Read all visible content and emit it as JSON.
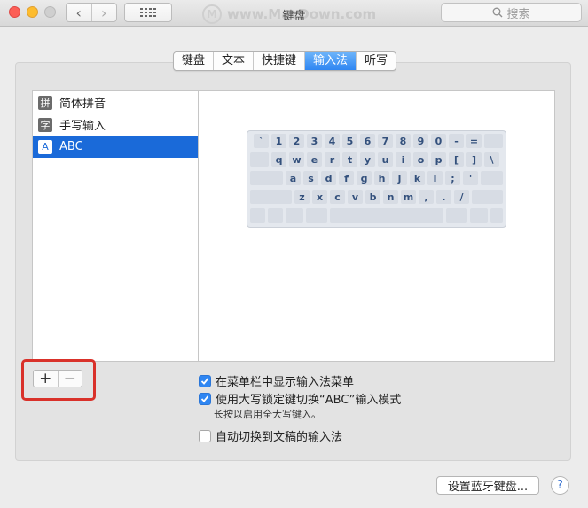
{
  "window": {
    "title": "键盘"
  },
  "toolbar": {
    "back_glyph": "‹",
    "forward_glyph": "›",
    "search_placeholder": "搜索"
  },
  "watermark": {
    "logo": "M",
    "text": "www.MacDown.com"
  },
  "tabs": [
    {
      "label": "键盘",
      "active": false
    },
    {
      "label": "文本",
      "active": false
    },
    {
      "label": "快捷键",
      "active": false
    },
    {
      "label": "输入法",
      "active": true
    },
    {
      "label": "听写",
      "active": false
    }
  ],
  "input_sources": [
    {
      "icon_text": "拼",
      "label": "简体拼音",
      "selected": false
    },
    {
      "icon_text": "字",
      "label": "手写输入",
      "selected": false
    },
    {
      "icon_text": "A",
      "label": "ABC",
      "selected": true
    }
  ],
  "keyboard_rows": [
    [
      "`",
      "1",
      "2",
      "3",
      "4",
      "5",
      "6",
      "7",
      "8",
      "9",
      "0",
      "-",
      "="
    ],
    [
      "q",
      "w",
      "e",
      "r",
      "t",
      "y",
      "u",
      "i",
      "o",
      "p",
      "[",
      "]",
      "\\"
    ],
    [
      "a",
      "s",
      "d",
      "f",
      "g",
      "h",
      "j",
      "k",
      "l",
      ";",
      "'"
    ],
    [
      "z",
      "x",
      "c",
      "v",
      "b",
      "n",
      "m",
      ",",
      ".",
      "/"
    ]
  ],
  "list_buttons": {
    "add": "+",
    "remove": "−"
  },
  "options": {
    "show_menu": {
      "label": "在菜单栏中显示输入法菜单",
      "checked": true
    },
    "caps_switch": {
      "label": "使用大写锁定键切换“ABC”输入模式",
      "checked": true
    },
    "caps_hint": "长按以启用全大写键入。",
    "auto_switch": {
      "label": "自动切换到文稿的输入法",
      "checked": false
    }
  },
  "bottom": {
    "bluetooth_button": "设置蓝牙键盘...",
    "help": "?"
  },
  "colors": {
    "accent": "#2f86f2",
    "selection": "#1a6ad9",
    "highlight_box": "#d9312a"
  }
}
